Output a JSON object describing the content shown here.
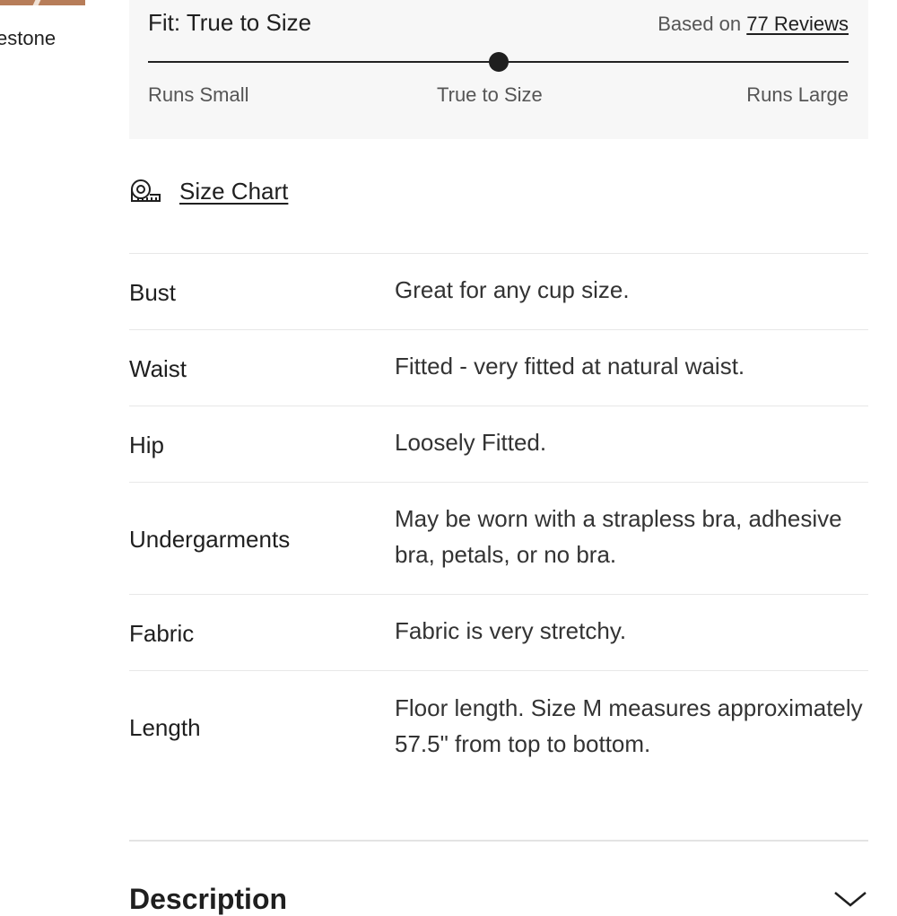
{
  "left_partial_label": "estone",
  "fit": {
    "title": "Fit: True to Size",
    "based_on": "Based on",
    "reviews_link": "77 Reviews",
    "scale": {
      "small": "Runs Small",
      "mid": "True to Size",
      "large": "Runs Large"
    },
    "marker_position_fraction": 0.5
  },
  "size_chart": {
    "label": "Size Chart",
    "icon": "measuring-tape-icon"
  },
  "details": [
    {
      "label": "Bust",
      "value": "Great for any cup size."
    },
    {
      "label": "Waist",
      "value": "Fitted - very fitted at natural waist."
    },
    {
      "label": "Hip",
      "value": "Loosely Fitted."
    },
    {
      "label": "Undergarments",
      "value": "May be worn with a strapless bra, adhesive bra, petals, or no bra."
    },
    {
      "label": "Fabric",
      "value": "Fabric is very stretchy."
    },
    {
      "label": "Length",
      "value": "Floor length. Size M measures approximately 57.5\" from top to bottom."
    }
  ],
  "description": {
    "title": "Description",
    "icon": "chevron-down-icon"
  }
}
